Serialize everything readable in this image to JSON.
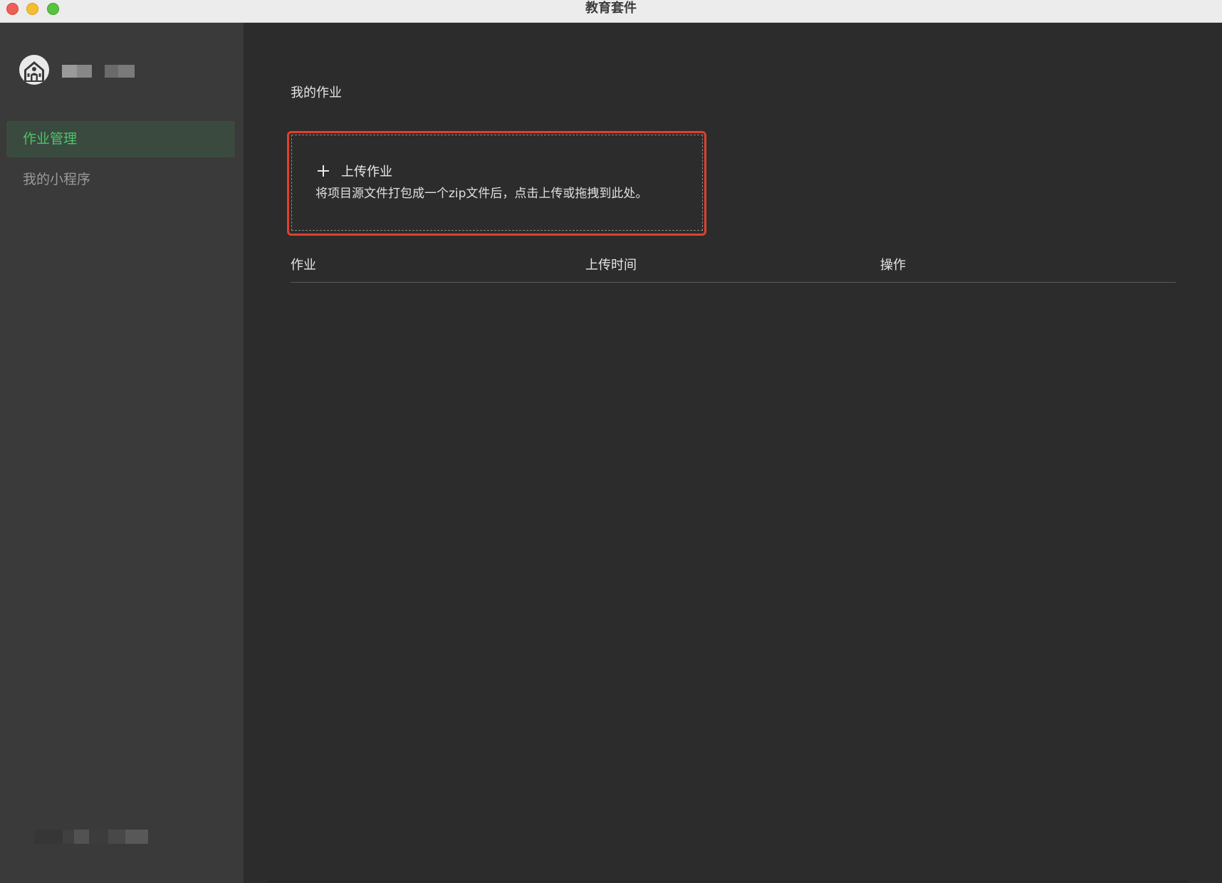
{
  "window": {
    "title": "教育套件"
  },
  "sidebar": {
    "logo_icon": "school-building-icon",
    "items": [
      {
        "label": "作业管理",
        "active": true
      },
      {
        "label": "我的小程序",
        "active": false
      }
    ]
  },
  "main": {
    "title": "我的作业",
    "upload": {
      "icon": "plus-icon",
      "label": "上传作业",
      "hint": "将项目源文件打包成一个zip文件后，点击上传或拖拽到此处。"
    },
    "table": {
      "columns": [
        "作业",
        "上传时间",
        "操作"
      ],
      "rows": []
    }
  },
  "colors": {
    "accent": "#4cc46a",
    "highlight_border": "#e0402e",
    "sidebar_bg": "#3a3a3a",
    "main_bg": "#2c2c2c"
  }
}
